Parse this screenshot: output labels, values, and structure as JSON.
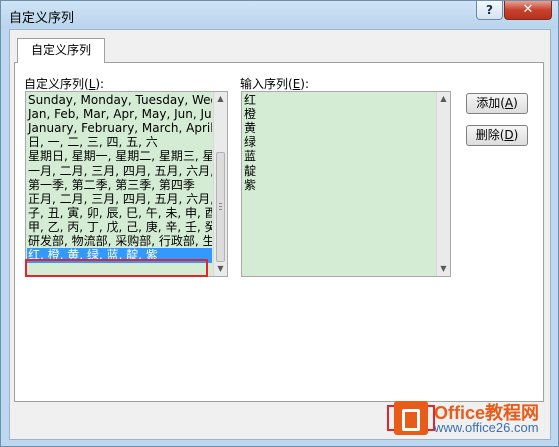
{
  "window": {
    "title": "自定义序列",
    "help_label": "?",
    "close_label": "✕"
  },
  "tab": {
    "label": "自定义序列"
  },
  "custom_list": {
    "label_prefix": "自定义序列(",
    "label_key": "L",
    "label_suffix": "):",
    "items": [
      "Sunday, Monday, Tuesday, Wed",
      "Jan, Feb, Mar, Apr, May, Jun, Ju",
      "January, February, March, April,",
      "日, 一, 二, 三, 四, 五, 六",
      "星期日, 星期一, 星期二, 星期三, 星",
      "一月, 二月, 三月, 四月, 五月, 六月,",
      "第一季, 第二季, 第三季, 第四季",
      "正月, 二月, 三月, 四月, 五月, 六月,",
      "子, 丑, 寅, 卯, 辰, 巳, 午, 未, 申, 酉",
      "甲, 乙, 丙, 丁, 戊, 己, 庚, 辛, 壬, 癸",
      "研发部, 物流部, 采购部, 行政部, 生",
      "红, 橙, 黄, 绿, 蓝, 靛, 紫"
    ],
    "selected_index": 11
  },
  "input_list": {
    "label_prefix": "输入序列(",
    "label_key": "E",
    "label_suffix": "):",
    "items": [
      "红",
      "橙",
      "黄",
      "绿",
      "蓝",
      "靛",
      "紫"
    ]
  },
  "buttons": {
    "add_prefix": "添加(",
    "add_key": "A",
    "add_suffix": ")",
    "delete_prefix": "删除(",
    "delete_key": "D",
    "delete_suffix": ")"
  },
  "watermark": {
    "brand": "Office教程网",
    "url": "www.office26.com"
  },
  "colors": {
    "list_bg": "#d5ecd4",
    "selection": "#3399ff",
    "highlight_outline": "#e3252b"
  }
}
